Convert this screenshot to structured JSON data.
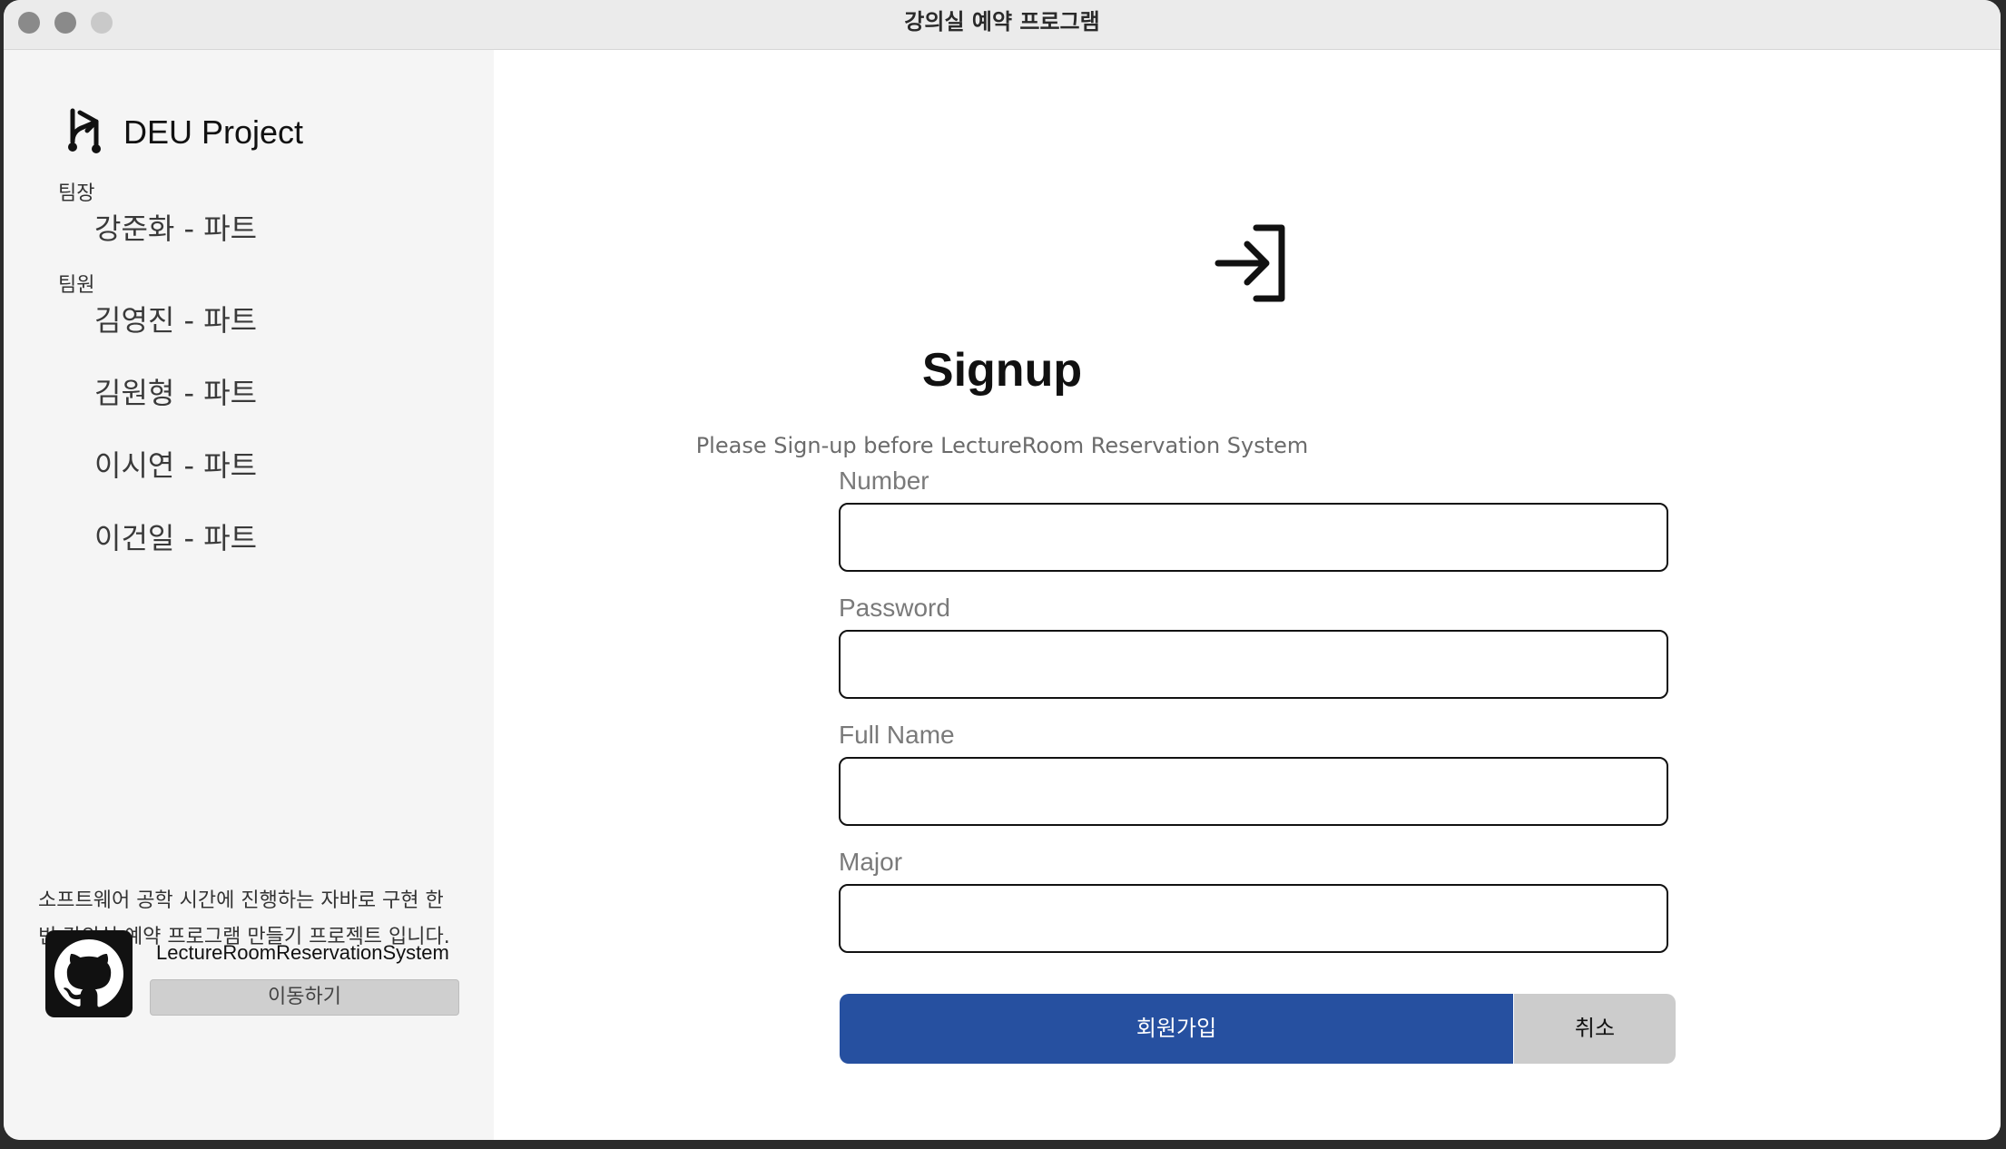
{
  "window": {
    "title": "강의실 예약 프로그램"
  },
  "sidebar": {
    "brand": "DEU Project",
    "leader_label": "팀장",
    "leader": "강준화 - 파트",
    "members_label": "팀원",
    "members": [
      "김영진 - 파트",
      "김원형 - 파트",
      "이시연 - 파트",
      "이건일 - 파트"
    ],
    "description": "소프트웨어 공학 시간에 진행하는 자바로 구현 한 빈 강의실 예약 프로그램 만들기 프로젝트 입니다.",
    "repo_name": "LectureRoomReservationSystem",
    "goto_label": "이동하기"
  },
  "main": {
    "heading": "Signup",
    "subtitle": "Please Sign-up before LectureRoom Reservation System",
    "fields": [
      {
        "label": "Number",
        "value": ""
      },
      {
        "label": "Password",
        "value": ""
      },
      {
        "label": "Full Name",
        "value": ""
      },
      {
        "label": "Major",
        "value": ""
      }
    ],
    "submit_label": "회원가입",
    "cancel_label": "취소"
  },
  "colors": {
    "primary": "#2650a0",
    "cancel": "#cccccc",
    "sidebar_bg": "#f5f5f5"
  },
  "icons": {
    "brand": "branch-icon",
    "hero": "sign-in-icon",
    "repo": "github-icon"
  }
}
